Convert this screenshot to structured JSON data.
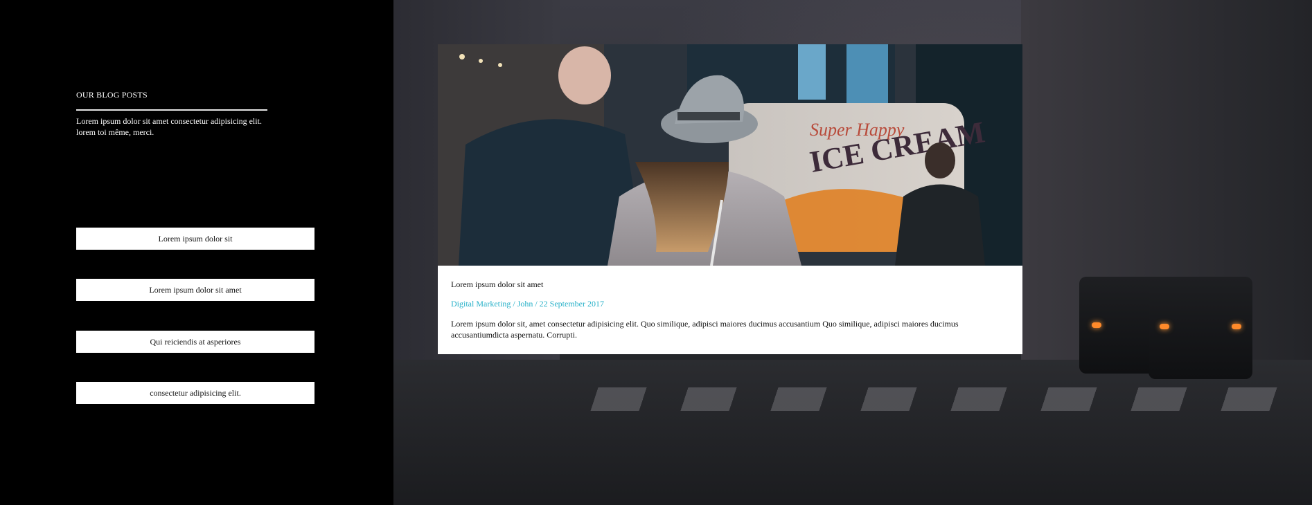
{
  "sidebar": {
    "title": "OUR BLOG POSTS",
    "description": "Lorem ipsum dolor sit amet consectetur adipisicing elit. lorem toi même, merci.",
    "buttons": [
      {
        "label": "Lorem ipsum dolor sit"
      },
      {
        "label": "Lorem ipsum dolor sit amet"
      },
      {
        "label": "Qui reiciendis at asperiores"
      },
      {
        "label": "consectetur adipisicing elit."
      }
    ]
  },
  "card": {
    "title": "Lorem ipsum dolor sit amet",
    "meta": "Digital Marketing / John / 22 September 2017",
    "excerpt": "Lorem ipsum dolor sit, amet consectetur adipisicing elit. Quo similique, adipisci maiores ducimus accusantium Quo similique, adipisci maiores ducimus accusantiumdicta aspernatu. Corrupti.",
    "image_sign_line1": "Super Happy",
    "image_sign_line2": "ICE CREAM"
  },
  "colors": {
    "accent": "#25b0c8",
    "sidebar_bg": "#000000",
    "button_bg": "#ffffff"
  }
}
